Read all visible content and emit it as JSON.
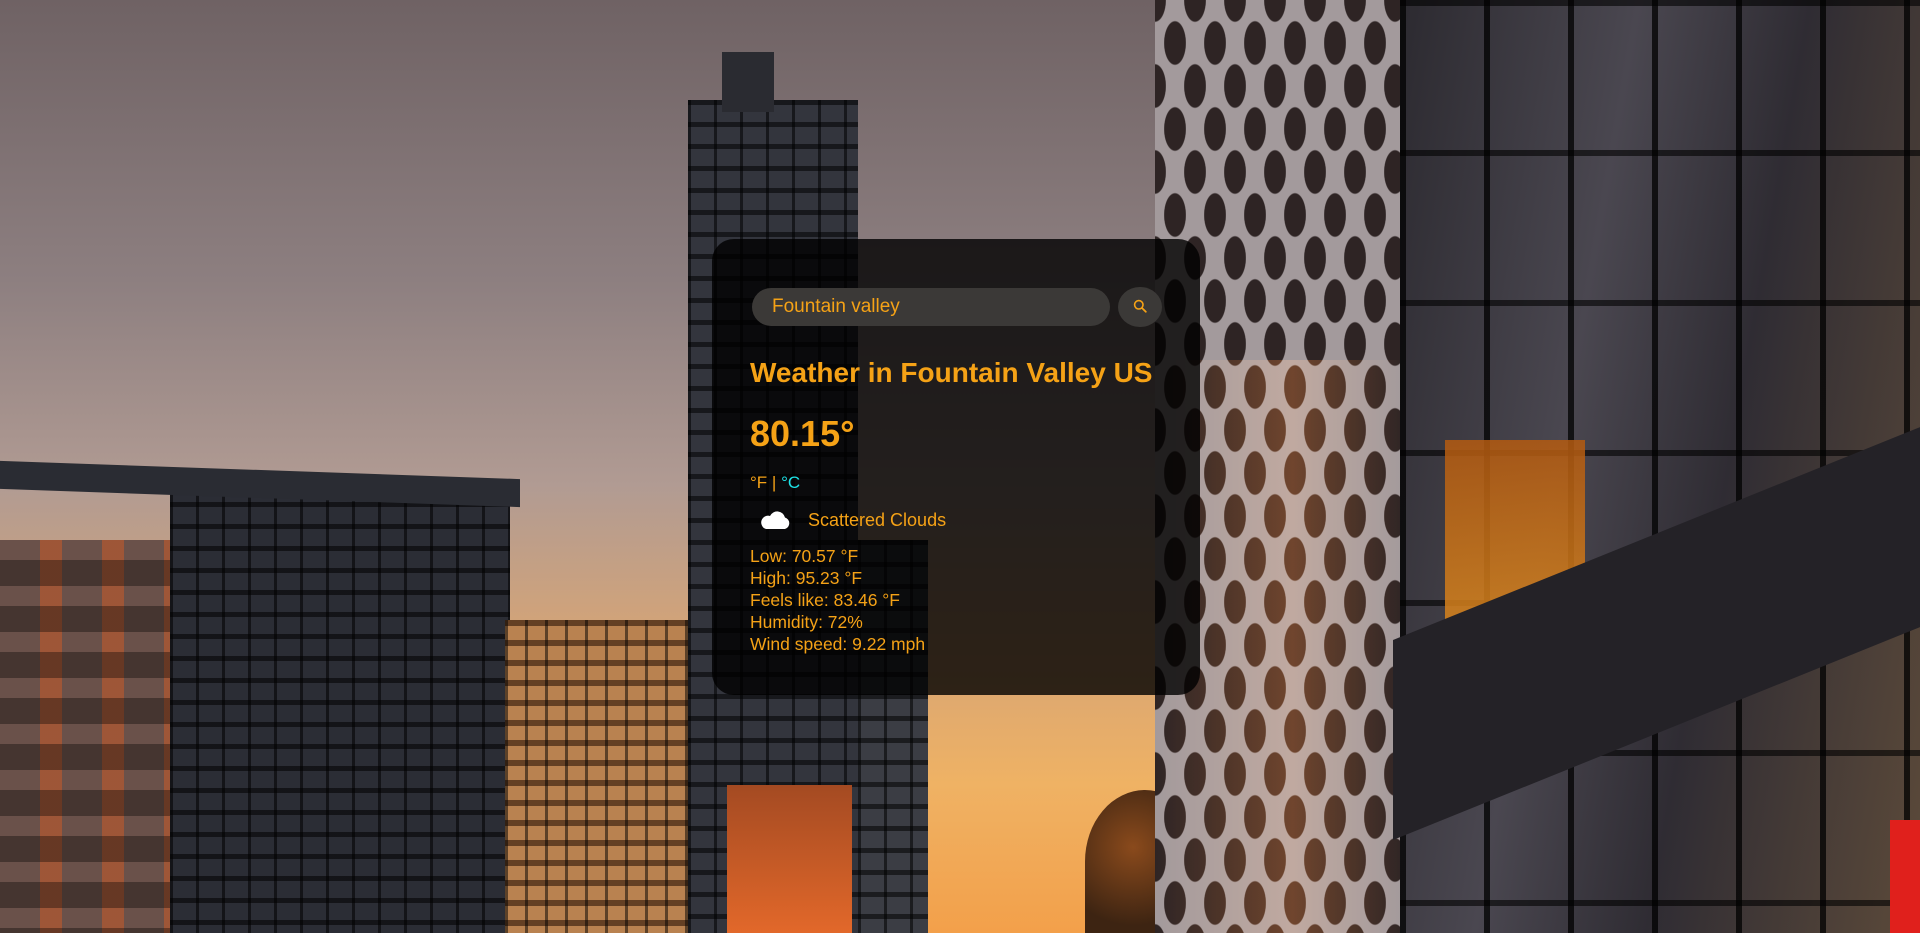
{
  "search": {
    "value": "Fountain valley",
    "placeholder": "Search"
  },
  "weather": {
    "city_heading": "Weather in Fountain Valley US",
    "temperature": "80.15°",
    "unit_f": "°F",
    "unit_separator": " | ",
    "unit_c": "°C",
    "description": "Scattered Clouds",
    "icon": "cloud-icon",
    "low": "Low: 70.57 °F",
    "high": "High: 95.23 °F",
    "feels_like": "Feels like: 83.46 °F",
    "humidity": "Humidity: 72%",
    "wind": "Wind speed: 9.22 mph"
  },
  "colors": {
    "accent": "#f5a216",
    "unit_active": "#1ee3e8",
    "card_bg": "rgba(0,0,0,0.8)",
    "input_bg": "#3b3937"
  }
}
